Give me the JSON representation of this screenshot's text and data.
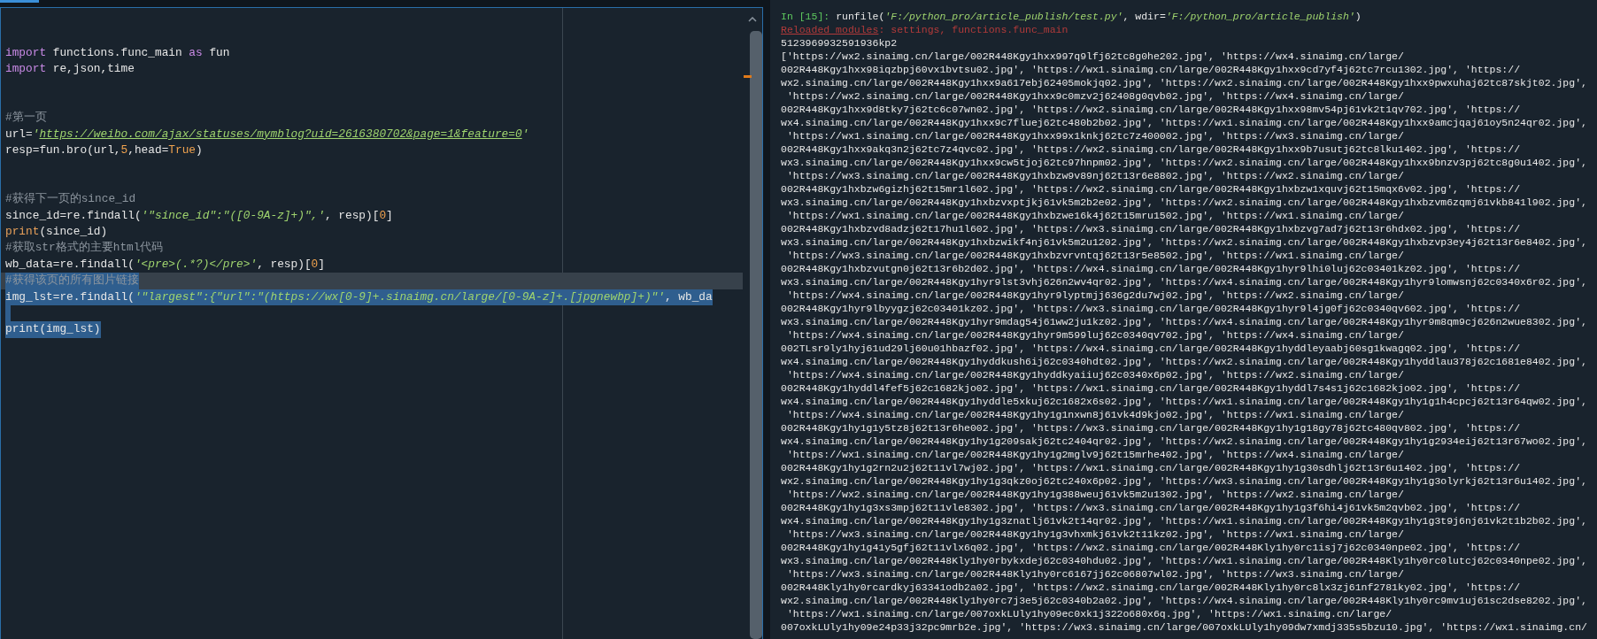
{
  "editor": {
    "lines": [
      {
        "selected": false,
        "current": false
      },
      {
        "selected": false,
        "current": false
      },
      {
        "selected": false,
        "current": false,
        "tokens": [
          {
            "text": "import",
            "kind": "keyword"
          },
          {
            "text": " functions.func_main ",
            "kind": "plain"
          },
          {
            "text": "as",
            "kind": "keyword"
          },
          {
            "text": " fun",
            "kind": "plain"
          }
        ]
      },
      {
        "selected": false,
        "current": false,
        "tokens": [
          {
            "text": "import",
            "kind": "keyword"
          },
          {
            "text": " re,json,time",
            "kind": "plain"
          }
        ]
      },
      {
        "selected": false,
        "current": false
      },
      {
        "selected": false,
        "current": false
      },
      {
        "selected": false,
        "current": false,
        "tokens": [
          {
            "text": "#第一页",
            "kind": "comment"
          }
        ]
      },
      {
        "selected": false,
        "current": false,
        "tokens": [
          {
            "text": "url=",
            "kind": "plain"
          },
          {
            "text": "'",
            "kind": "string"
          },
          {
            "text": "https://weibo.com/ajax/statuses/mymblog?uid=2616380702&page=1&feature=0",
            "kind": "link"
          },
          {
            "text": "'",
            "kind": "string"
          }
        ]
      },
      {
        "selected": false,
        "current": false,
        "tokens": [
          {
            "text": "resp=fun.bro(url,",
            "kind": "plain"
          },
          {
            "text": "5",
            "kind": "number"
          },
          {
            "text": ",head=",
            "kind": "plain"
          },
          {
            "text": "True",
            "kind": "number"
          },
          {
            "text": ")",
            "kind": "plain"
          }
        ]
      },
      {
        "selected": false,
        "current": false
      },
      {
        "selected": false,
        "current": false
      },
      {
        "selected": false,
        "current": false,
        "tokens": [
          {
            "text": "#获得下一页的since_id",
            "kind": "comment"
          }
        ]
      },
      {
        "selected": false,
        "current": false,
        "tokens": [
          {
            "text": "since_id=re.findall(",
            "kind": "plain"
          },
          {
            "text": "'\"since_id\":\"([0-9A-z]+)\",'",
            "kind": "string"
          },
          {
            "text": ", resp)[",
            "kind": "plain"
          },
          {
            "text": "0",
            "kind": "number"
          },
          {
            "text": "]",
            "kind": "plain"
          }
        ]
      },
      {
        "selected": false,
        "current": false,
        "tokens": [
          {
            "text": "print",
            "kind": "builtin"
          },
          {
            "text": "(since_id)",
            "kind": "plain"
          }
        ]
      },
      {
        "selected": false,
        "current": false,
        "tokens": [
          {
            "text": "#获取str格式的主要html代码",
            "kind": "comment"
          }
        ]
      },
      {
        "selected": false,
        "current": false,
        "tokens": [
          {
            "text": "wb_data=re.findall(",
            "kind": "plain"
          },
          {
            "text": "'<pre>(.*?)</pre>'",
            "kind": "string"
          },
          {
            "text": ", resp)[",
            "kind": "plain"
          },
          {
            "text": "0",
            "kind": "number"
          },
          {
            "text": "]",
            "kind": "plain"
          }
        ]
      },
      {
        "selected": true,
        "current": true,
        "tokens": [
          {
            "text": "#获得该页的所有图片链接",
            "kind": "comment"
          }
        ]
      },
      {
        "selected": true,
        "current": false,
        "tokens": [
          {
            "text": "img_lst=re.findall(",
            "kind": "plain"
          },
          {
            "text": "'\"largest\":{\"url\":\"(https://wx[0-9]+.sinaimg.cn/large/[0-9A-z]+.[jpgnewbp]+)\"'",
            "kind": "string"
          },
          {
            "text": ", wb_da",
            "kind": "plain"
          }
        ]
      },
      {
        "selected": true,
        "current": false
      },
      {
        "selected": true,
        "current": false,
        "tokens": [
          {
            "text": "print",
            "kind": "plain"
          },
          {
            "text": "(img_lst)",
            "kind": "plain"
          }
        ]
      }
    ]
  },
  "console": {
    "lines": [
      {
        "segments": [
          {
            "text": "In [15]: ",
            "kind": "prompt"
          },
          {
            "text": "runfile(",
            "kind": "output"
          },
          {
            "text": "'F:/python_pro/article_publish/test.py'",
            "kind": "string"
          },
          {
            "text": ", wdir=",
            "kind": "output"
          },
          {
            "text": "'F:/python_pro/article_publish'",
            "kind": "string"
          },
          {
            "text": ")",
            "kind": "output"
          }
        ]
      },
      {
        "segments": [
          {
            "text": "Reloaded modules",
            "kind": "error-link"
          },
          {
            "text": ": settings, functions.func_main",
            "kind": "error"
          }
        ]
      },
      {
        "segments": [
          {
            "text": "5123969932591936kp2",
            "kind": "output"
          }
        ]
      },
      {
        "segments": [
          {
            "text": "['https://wx2.sinaimg.cn/large/002R448Kgy1hxx997q9lfj62tc8g0he202.jpg', 'https://wx4.sinaimg.cn/large/",
            "kind": "output"
          }
        ]
      },
      {
        "segments": [
          {
            "text": "002R448Kgy1hxx98iqzbpj60vx1bvtsu02.jpg', 'https://wx1.sinaimg.cn/large/002R448Kgy1hxx9cd7yf4j62tc7rcu1302.jpg', 'https://",
            "kind": "output"
          }
        ]
      },
      {
        "segments": [
          {
            "text": "wx2.sinaimg.cn/large/002R448Kgy1hxx9a617ebj62405mokjq02.jpg', 'https://wx2.sinaimg.cn/large/002R448Kgy1hxx9pwxuhaj62tc87skjt02.jpg',",
            "kind": "output"
          }
        ]
      },
      {
        "segments": [
          {
            "text": " 'https://wx2.sinaimg.cn/large/002R448Kgy1hxx9c0mzv2j62408g0qvb02.jpg', 'https://wx4.sinaimg.cn/large/",
            "kind": "output"
          }
        ]
      },
      {
        "segments": [
          {
            "text": "002R448Kgy1hxx9d8tky7j62tc6c07wn02.jpg', 'https://wx2.sinaimg.cn/large/002R448Kgy1hxx98mv54pj61vk2t1qv702.jpg', 'https://",
            "kind": "output"
          }
        ]
      },
      {
        "segments": [
          {
            "text": "wx4.sinaimg.cn/large/002R448Kgy1hxx9c7fluej62tc480b2b02.jpg', 'https://wx1.sinaimg.cn/large/002R448Kgy1hxx9amcjqaj61oy5n24qr02.jpg',",
            "kind": "output"
          }
        ]
      },
      {
        "segments": [
          {
            "text": " 'https://wx1.sinaimg.cn/large/002R448Kgy1hxx99x1knkj62tc7z400002.jpg', 'https://wx3.sinaimg.cn/large/",
            "kind": "output"
          }
        ]
      },
      {
        "segments": [
          {
            "text": "002R448Kgy1hxx9akq3n2j62tc7z4qvc02.jpg', 'https://wx2.sinaimg.cn/large/002R448Kgy1hxx9b7usutj62tc8lku1402.jpg', 'https://",
            "kind": "output"
          }
        ]
      },
      {
        "segments": [
          {
            "text": "wx3.sinaimg.cn/large/002R448Kgy1hxx9cw5tjoj62tc97hnpm02.jpg', 'https://wx2.sinaimg.cn/large/002R448Kgy1hxx9bnzv3pj62tc8g0u1402.jpg',",
            "kind": "output"
          }
        ]
      },
      {
        "segments": [
          {
            "text": " 'https://wx3.sinaimg.cn/large/002R448Kgy1hxbzw9v89nj62t13r6e8802.jpg', 'https://wx2.sinaimg.cn/large/",
            "kind": "output"
          }
        ]
      },
      {
        "segments": [
          {
            "text": "002R448Kgy1hxbzw6gizhj62t15mr1l602.jpg', 'https://wx2.sinaimg.cn/large/002R448Kgy1hxbzw1xquvj62t15mqx6v02.jpg', 'https://",
            "kind": "output"
          }
        ]
      },
      {
        "segments": [
          {
            "text": "wx3.sinaimg.cn/large/002R448Kgy1hxbzvxptjkj61vk5m2b2e02.jpg', 'https://wx2.sinaimg.cn/large/002R448Kgy1hxbzvm6zqmj61vkb841l902.jpg',",
            "kind": "output"
          }
        ]
      },
      {
        "segments": [
          {
            "text": " 'https://wx1.sinaimg.cn/large/002R448Kgy1hxbzwe16k4j62t15mru1502.jpg', 'https://wx1.sinaimg.cn/large/",
            "kind": "output"
          }
        ]
      },
      {
        "segments": [
          {
            "text": "002R448Kgy1hxbzvd8adzj62t17hu1l602.jpg', 'https://wx3.sinaimg.cn/large/002R448Kgy1hxbzvg7ad7j62t13r6hdx02.jpg', 'https://",
            "kind": "output"
          }
        ]
      },
      {
        "segments": [
          {
            "text": "wx3.sinaimg.cn/large/002R448Kgy1hxbzwikf4nj61vk5m2u1202.jpg', 'https://wx2.sinaimg.cn/large/002R448Kgy1hxbzvp3ey4j62t13r6e8402.jpg',",
            "kind": "output"
          }
        ]
      },
      {
        "segments": [
          {
            "text": " 'https://wx3.sinaimg.cn/large/002R448Kgy1hxbzvrvntqj62t13r5e8502.jpg', 'https://wx1.sinaimg.cn/large/",
            "kind": "output"
          }
        ]
      },
      {
        "segments": [
          {
            "text": "002R448Kgy1hxbzvutgn0j62t13r6b2d02.jpg', 'https://wx4.sinaimg.cn/large/002R448Kgy1hyr9lhi0luj62c03401kz02.jpg', 'https://",
            "kind": "output"
          }
        ]
      },
      {
        "segments": [
          {
            "text": "wx3.sinaimg.cn/large/002R448Kgy1hyr9lst3vhj626n2wv4qr02.jpg', 'https://wx4.sinaimg.cn/large/002R448Kgy1hyr9lomwsnj62c0340x6r02.jpg',",
            "kind": "output"
          }
        ]
      },
      {
        "segments": [
          {
            "text": " 'https://wx4.sinaimg.cn/large/002R448Kgy1hyr9lyptmjj636g2du7wj02.jpg', 'https://wx2.sinaimg.cn/large/",
            "kind": "output"
          }
        ]
      },
      {
        "segments": [
          {
            "text": "002R448Kgy1hyr9lbyygzj62c03401kz02.jpg', 'https://wx3.sinaimg.cn/large/002R448Kgy1hyr9l4jg0fj62c0340qv602.jpg', 'https://",
            "kind": "output"
          }
        ]
      },
      {
        "segments": [
          {
            "text": "wx3.sinaimg.cn/large/002R448Kgy1hyr9mdag54j61ww2ju1kz02.jpg', 'https://wx4.sinaimg.cn/large/002R448Kgy1hyr9m8qm9cj626n2wue8302.jpg',",
            "kind": "output"
          }
        ]
      },
      {
        "segments": [
          {
            "text": " 'https://wx4.sinaimg.cn/large/002R448Kgy1hyr9m599luj62c0340qv702.jpg', 'https://wx4.sinaimg.cn/large/",
            "kind": "output"
          }
        ]
      },
      {
        "segments": [
          {
            "text": "002TLsr9ly1hyj61ud29lj60u01hbazf02.jpg', 'https://wx4.sinaimg.cn/large/002R448Kgy1hyddleyaabj60sg1kwagq02.jpg', 'https://",
            "kind": "output"
          }
        ]
      },
      {
        "segments": [
          {
            "text": "wx4.sinaimg.cn/large/002R448Kgy1hyddkush6ij62c0340hdt02.jpg', 'https://wx2.sinaimg.cn/large/002R448Kgy1hyddlau378j62c1681e8402.jpg',",
            "kind": "output"
          }
        ]
      },
      {
        "segments": [
          {
            "text": " 'https://wx4.sinaimg.cn/large/002R448Kgy1hyddkyaiiuj62c0340x6p02.jpg', 'https://wx2.sinaimg.cn/large/",
            "kind": "output"
          }
        ]
      },
      {
        "segments": [
          {
            "text": "002R448Kgy1hyddl4fef5j62c1682kjo02.jpg', 'https://wx1.sinaimg.cn/large/002R448Kgy1hyddl7s4s1j62c1682kjo02.jpg', 'https://",
            "kind": "output"
          }
        ]
      },
      {
        "segments": [
          {
            "text": "wx4.sinaimg.cn/large/002R448Kgy1hyddle5xkuj62c1682x6s02.jpg', 'https://wx1.sinaimg.cn/large/002R448Kgy1hy1g1h4cpcj62t13r64qw02.jpg',",
            "kind": "output"
          }
        ]
      },
      {
        "segments": [
          {
            "text": " 'https://wx4.sinaimg.cn/large/002R448Kgy1hy1g1nxwn8j61vk4d9kjo02.jpg', 'https://wx1.sinaimg.cn/large/",
            "kind": "output"
          }
        ]
      },
      {
        "segments": [
          {
            "text": "002R448Kgy1hy1g1y5tz8j62t13r6he002.jpg', 'https://wx3.sinaimg.cn/large/002R448Kgy1hy1g18gy78j62tc480qv802.jpg', 'https://",
            "kind": "output"
          }
        ]
      },
      {
        "segments": [
          {
            "text": "wx4.sinaimg.cn/large/002R448Kgy1hy1g209sakj62tc2404qr02.jpg', 'https://wx2.sinaimg.cn/large/002R448Kgy1hy1g2934eij62t13r67wo02.jpg',",
            "kind": "output"
          }
        ]
      },
      {
        "segments": [
          {
            "text": " 'https://wx1.sinaimg.cn/large/002R448Kgy1hy1g2mglv9j62t15mrhe402.jpg', 'https://wx4.sinaimg.cn/large/",
            "kind": "output"
          }
        ]
      },
      {
        "segments": [
          {
            "text": "002R448Kgy1hy1g2rn2u2j62t11vl7wj02.jpg', 'https://wx1.sinaimg.cn/large/002R448Kgy1hy1g30sdhlj62t13r6u1402.jpg', 'https://",
            "kind": "output"
          }
        ]
      },
      {
        "segments": [
          {
            "text": "wx2.sinaimg.cn/large/002R448Kgy1hy1g3qkz0oj62tc240x6p02.jpg', 'https://wx3.sinaimg.cn/large/002R448Kgy1hy1g3olyrkj62t13r6u1402.jpg',",
            "kind": "output"
          }
        ]
      },
      {
        "segments": [
          {
            "text": " 'https://wx2.sinaimg.cn/large/002R448Kgy1hy1g388weuj61vk5m2u1302.jpg', 'https://wx2.sinaimg.cn/large/",
            "kind": "output"
          }
        ]
      },
      {
        "segments": [
          {
            "text": "002R448Kgy1hy1g3xs3mpj62t11vle8302.jpg', 'https://wx3.sinaimg.cn/large/002R448Kgy1hy1g3f6hi4j61vk5m2qvb02.jpg', 'https://",
            "kind": "output"
          }
        ]
      },
      {
        "segments": [
          {
            "text": "wx4.sinaimg.cn/large/002R448Kgy1hy1g3znatlj61vk2t14qr02.jpg', 'https://wx1.sinaimg.cn/large/002R448Kgy1hy1g3t9j6nj61vk2t1b2b02.jpg',",
            "kind": "output"
          }
        ]
      },
      {
        "segments": [
          {
            "text": " 'https://wx3.sinaimg.cn/large/002R448Kgy1hy1g3vhxmkj61vk2t11kz02.jpg', 'https://wx1.sinaimg.cn/large/",
            "kind": "output"
          }
        ]
      },
      {
        "segments": [
          {
            "text": "002R448Kgy1hy1g41y5gfj62t11vlx6q02.jpg', 'https://wx2.sinaimg.cn/large/002R448Kly1hy0rc1isj7j62c0340npe02.jpg', 'https://",
            "kind": "output"
          }
        ]
      },
      {
        "segments": [
          {
            "text": "wx3.sinaimg.cn/large/002R448Kly1hy0rbykxdej62c0340hdu02.jpg', 'https://wx1.sinaimg.cn/large/002R448Kly1hy0rc0lutcj62c0340npe02.jpg',",
            "kind": "output"
          }
        ]
      },
      {
        "segments": [
          {
            "text": " 'https://wx3.sinaimg.cn/large/002R448Kly1hy0rc6167jj62c06807wl02.jpg', 'https://wx3.sinaimg.cn/large/",
            "kind": "output"
          }
        ]
      },
      {
        "segments": [
          {
            "text": "002R448Kly1hy0rcardkyj63341odb2a02.jpg', 'https://wx2.sinaimg.cn/large/002R448Kly1hy0rc8lx3zj61nf2781ky02.jpg', 'https://",
            "kind": "output"
          }
        ]
      },
      {
        "segments": [
          {
            "text": "wx2.sinaimg.cn/large/002R448Kly1hy0rc7j3e5j62c0340b2a02.jpg', 'https://wx4.sinaimg.cn/large/002R448Kly1hy0rc9mv1uj61sc2dse8202.jpg',",
            "kind": "output"
          }
        ]
      },
      {
        "segments": [
          {
            "text": " 'https://wx1.sinaimg.cn/large/007oxkLUly1hy09ec0xk1j322o680x6q.jpg', 'https://wx1.sinaimg.cn/large/",
            "kind": "output"
          }
        ]
      },
      {
        "segments": [
          {
            "text": "007oxkLUly1hy09e24p33j32pc9mrb2e.jpg', 'https://wx3.sinaimg.cn/large/007oxkLUly1hy09dw7xmdj335s5bzu10.jpg', 'https://wx1.sinaimg.cn/",
            "kind": "output"
          }
        ]
      }
    ]
  }
}
